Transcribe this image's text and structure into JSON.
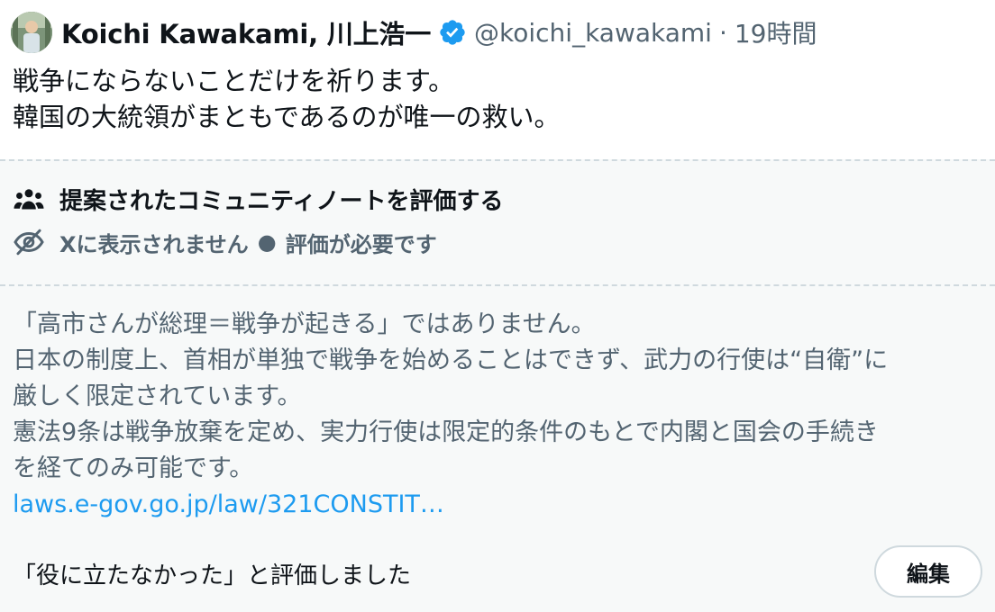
{
  "tweet": {
    "author_name": "Koichi Kawakami, 川上浩一",
    "handle": "@koichi_kawakami",
    "separator": "·",
    "time": "19時間",
    "lines": [
      "戦争にならないことだけを祈ります。",
      "韓国の大統領がまともであるのが唯一の救い。"
    ],
    "verified_icon": "verified-badge-icon"
  },
  "community_note": {
    "title": "提案されたコミュニティノートを評価する",
    "status_left": "Xに表示されません",
    "status_bullet": "●",
    "status_right": "評価が必要です",
    "body_lines": [
      "「高市さんが総理＝戦争が起きる」ではありません。",
      "日本の制度上、首相が単独で戦争を始めることはできず、武力の行使は“自衛”に",
      "厳しく限定されています。",
      "憲法9条は戦争放棄を定め、実力行使は限定的条件のもとで内閣と国会の手続き",
      "を経てのみ可能です。"
    ],
    "link": "laws.e-gov.go.jp/law/321CONSTIT…",
    "rated_text": "「役に立たなかった」と評価しました",
    "edit_label": "編集",
    "icons": {
      "title_icon": "people-icon",
      "status_icon": "eye-off-icon"
    }
  },
  "colors": {
    "text_primary": "#0f1419",
    "text_secondary": "#536471",
    "link": "#1d9bf0",
    "verified": "#1d9bf0",
    "panel_bg": "#f7f9f9",
    "border": "#cfd9de"
  }
}
